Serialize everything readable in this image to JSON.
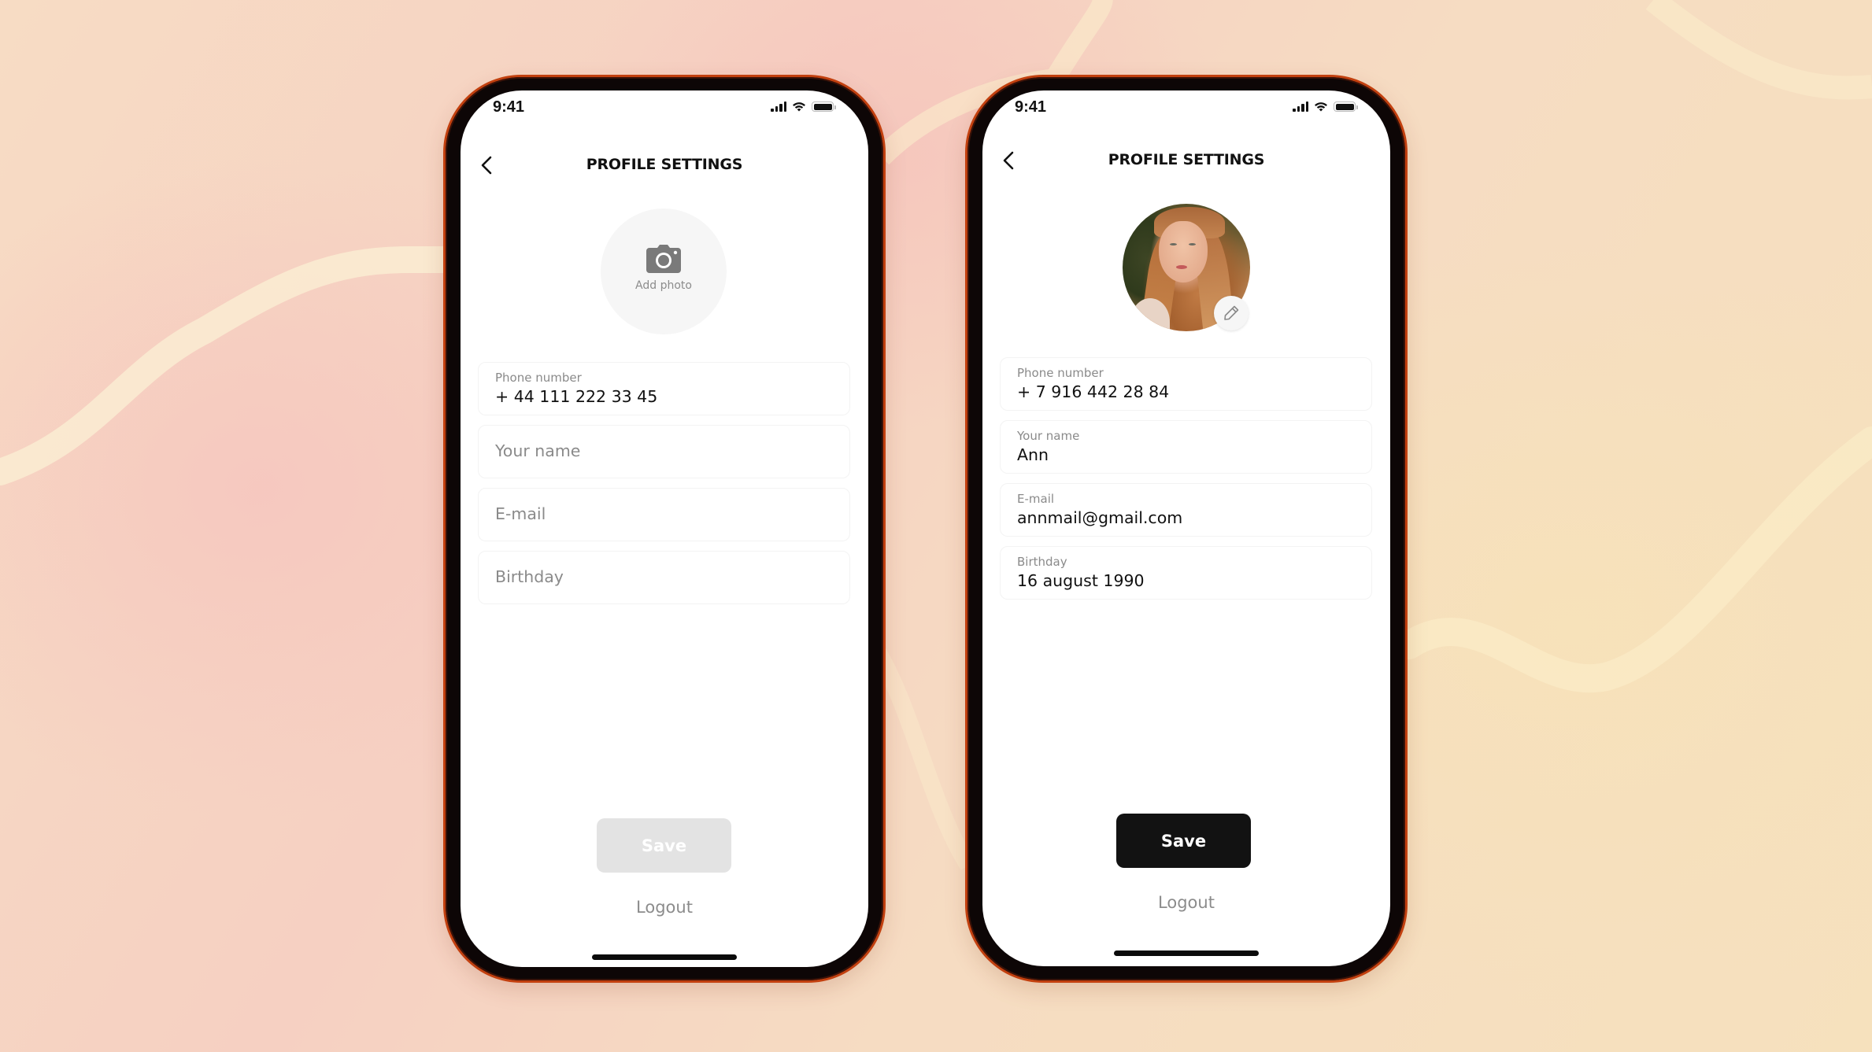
{
  "screens": [
    {
      "state": "empty",
      "status_bar": {
        "time": "9:41",
        "icons": [
          "cellular-signal-icon",
          "wifi-icon",
          "battery-icon"
        ]
      },
      "header": {
        "back_icon": "chevron-left-icon",
        "title": "PROFILE SETTINGS"
      },
      "photo": {
        "icon": "camera-icon",
        "label": "Add photo"
      },
      "fields": [
        {
          "label": "Phone number",
          "value": "+ 44 111 222 33 45",
          "placeholder": ""
        },
        {
          "label": "",
          "value": "",
          "placeholder": "Your name"
        },
        {
          "label": "",
          "value": "",
          "placeholder": "E-mail"
        },
        {
          "label": "",
          "value": "",
          "placeholder": "Birthday"
        }
      ],
      "save_button": {
        "label": "Save",
        "enabled": false
      },
      "logout_label": "Logout"
    },
    {
      "state": "filled",
      "status_bar": {
        "time": "9:41",
        "icons": [
          "cellular-signal-icon",
          "wifi-icon",
          "battery-icon"
        ]
      },
      "header": {
        "back_icon": "chevron-left-icon",
        "title": "PROFILE SETTINGS"
      },
      "photo": {
        "icon": "avatar-photo",
        "edit_icon": "pencil-icon"
      },
      "fields": [
        {
          "label": "Phone number",
          "value": "+ 7 916 442 28 84"
        },
        {
          "label": "Your name",
          "value": "Ann"
        },
        {
          "label": "E-mail",
          "value": "annmail@gmail.com"
        },
        {
          "label": "Birthday",
          "value": "16 august 1990"
        }
      ],
      "save_button": {
        "label": "Save",
        "enabled": true
      },
      "logout_label": "Logout"
    }
  ],
  "colors": {
    "primary_button": "#121212",
    "disabled_button": "#e3e3e3",
    "muted_text": "#8a8a8a",
    "phone_frame": "#0d0606",
    "frame_accent": "#c2400f"
  }
}
